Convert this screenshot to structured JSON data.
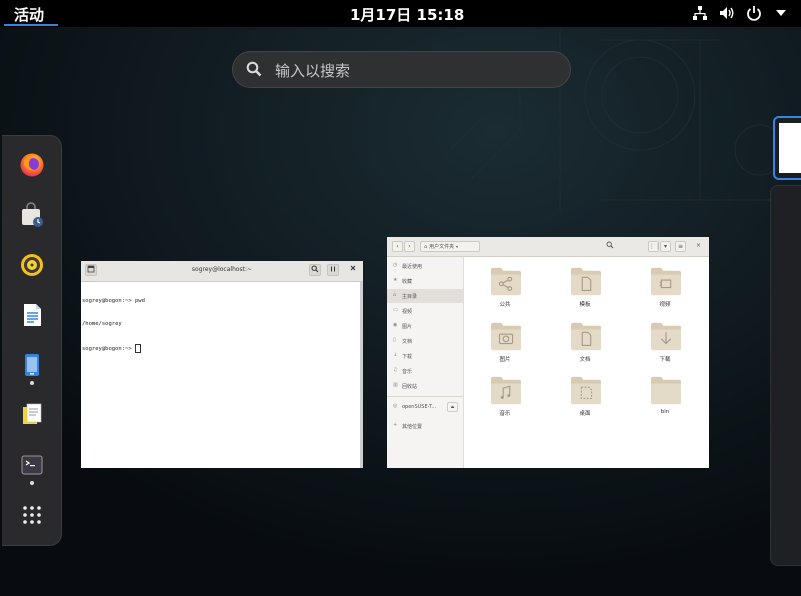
{
  "topbar": {
    "activities_label": "活动",
    "clock": "1月17日  15:18",
    "tray_icons": [
      "network-icon",
      "volume-icon",
      "power-icon",
      "system-menu-arrow-icon"
    ]
  },
  "search": {
    "placeholder": "输入以搜索"
  },
  "dash": {
    "items": [
      "firefox",
      "software",
      "rhythmbox",
      "libreoffice-writer",
      "files",
      "text-editor",
      "terminal",
      "show-applications"
    ]
  },
  "terminal_window": {
    "title": "sogrey@localhost:~",
    "lines": [
      "sogrey@bogon:~> pwd",
      "/home/sogrey",
      "sogrey@bogon:~> "
    ]
  },
  "files_window": {
    "path": "用户文件夹",
    "sidebar": [
      "最近使用",
      "收藏",
      "主目录",
      "视频",
      "图片",
      "文档",
      "下载",
      "音乐",
      "回收站",
      "openSUSE-T...",
      "其他位置"
    ],
    "folders": [
      "公共",
      "模板",
      "视频",
      "图片",
      "文档",
      "下载",
      "音乐",
      "桌面",
      "bin"
    ]
  },
  "colors": {
    "accent": "#3584e4",
    "folder": "#d8cbb4"
  }
}
